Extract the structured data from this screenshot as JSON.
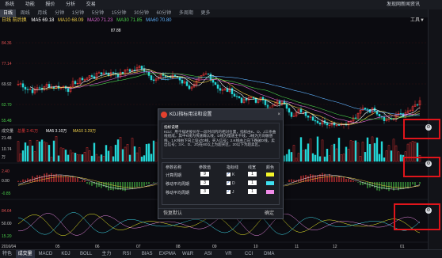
{
  "menubar": {
    "items": [
      "系统",
      "功能",
      "报价",
      "分析",
      "交易",
      "发现网新闻资讯"
    ],
    "right": "东 通 网 新 闻 资 讯"
  },
  "period_tabs": [
    "日线",
    "周线",
    "月线",
    "分钟",
    "1分钟",
    "5分钟",
    "15分钟",
    "30分钟",
    "60分钟",
    "多周期",
    "更多"
  ],
  "ma_legend": {
    "label": "日线 前后换",
    "items": [
      {
        "text": "MA5 69.18",
        "color": "#ffffff"
      },
      {
        "text": "MA10 68.09",
        "color": "#f2d14a"
      },
      {
        "text": "MA20 71.23",
        "color": "#e06bd5"
      },
      {
        "text": "MA30 71.85",
        "color": "#4bd14b"
      },
      {
        "text": "MA60 70.80",
        "color": "#5fb3ff"
      }
    ],
    "tools": "工具▼"
  },
  "price_labels": {
    "top": "87.88",
    "left": [
      "84.36",
      "77.14",
      "69.92",
      "62.70",
      "55.48"
    ]
  },
  "vol_legend": {
    "label": "成交量",
    "items": [
      {
        "text": "总量 2.41万",
        "color": "#e83a3a"
      },
      {
        "text": "MA5 3.10万",
        "color": "#ffffff"
      },
      {
        "text": "MA10 3.29万",
        "color": "#f2d14a"
      }
    ],
    "axis": [
      "21.48",
      "10.74",
      "万"
    ]
  },
  "macd_axis": [
    "2.40",
    "0.00",
    "-0.85"
  ],
  "kdj_axis": [
    "84.64",
    "50.00",
    "15.20"
  ],
  "dates": [
    "2016/04",
    "05",
    "06",
    "07",
    "08",
    "09",
    "10",
    "11",
    "12",
    "01"
  ],
  "dialog": {
    "title": "KDJ指标用法和设置",
    "close": "×",
    "desc_title": "指标说明",
    "desc": "KDJ：用于描述股价在一段时间内的相对位置，指标由K、D、J三条曲线组成，其中K线为快速确认线，D线为慢速主干线，J线为方向敏感线。1.K线由下向上穿过D线，买入信号；2.K线由上向下跌破D线，卖出信号；3.K、D、J均在80以上为超买区，20以下为超卖区。",
    "headers": [
      "参数名称",
      "参数值",
      "指标线",
      "线宽",
      "颜色"
    ],
    "rows": [
      {
        "name": "计算周期",
        "value": "9",
        "line": "K",
        "width": "1",
        "color": "#f5f52a"
      },
      {
        "name": "移动平均周期",
        "value": "3",
        "line": "D",
        "width": "1",
        "color": "#3fe0f0"
      },
      {
        "name": "移动平均周期",
        "value": "3",
        "line": "J",
        "width": "1",
        "color": "#f08ce8"
      }
    ],
    "reset": "恢复默认",
    "confirm": "确定"
  },
  "bottom_tabs": [
    "成交量",
    "MACD",
    "KDJ",
    "BOLL",
    "主力",
    "RSI",
    "BIAS",
    "EXPMA",
    "W&R",
    "ASI",
    "VR",
    "CCI",
    "DMA"
  ],
  "bottom_first": "特色",
  "active_bottom": "成交量",
  "active_period": "日线"
}
